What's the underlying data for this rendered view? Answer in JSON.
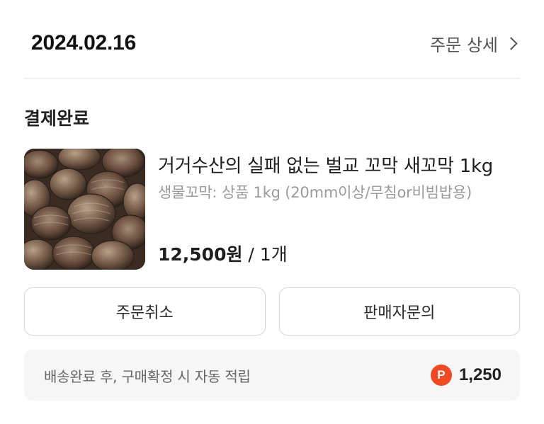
{
  "order": {
    "date": "2024.02.16",
    "detail_label": "주문 상세",
    "status": "결제완료"
  },
  "product": {
    "image_icon": "cockle-photo",
    "name": "거거수산의 실패 없는 벌교 꼬막 새꼬막 1kg",
    "option": "생물꼬막: 상품 1kg (20mm이상/무침or비빔밥용)",
    "price": "12,500원",
    "price_sep": " / ",
    "quantity": "1개"
  },
  "actions": {
    "cancel_label": "주문취소",
    "inquiry_label": "판매자문의"
  },
  "points": {
    "note": "배송완료 후, 구매확정 시 자동 적립",
    "icon_letter": "P",
    "amount": "1,250",
    "icon_color": "#ef4a21"
  }
}
